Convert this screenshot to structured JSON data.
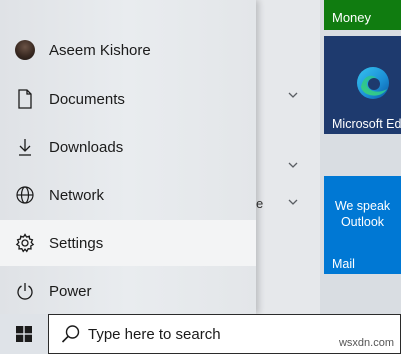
{
  "sidebar": {
    "user": {
      "name": "Aseem Kishore"
    },
    "items": [
      {
        "label": "Documents",
        "icon": "document-icon"
      },
      {
        "label": "Downloads",
        "icon": "download-icon"
      },
      {
        "label": "Network",
        "icon": "network-icon"
      },
      {
        "label": "Settings",
        "icon": "gear-icon"
      },
      {
        "label": "Power",
        "icon": "power-icon"
      }
    ]
  },
  "app_list": {
    "partial_text": "e"
  },
  "tiles": {
    "money": {
      "label": "Money",
      "color": "#107c10"
    },
    "edge": {
      "label": "Microsoft Edge",
      "color": "#1e3a6e"
    },
    "mail": {
      "message_line1": "We speak",
      "message_line2": "Outlook",
      "label": "Mail",
      "color": "#0078d4"
    }
  },
  "taskbar": {
    "search_placeholder": "Type here to search"
  },
  "watermark": "wsxdn.com"
}
